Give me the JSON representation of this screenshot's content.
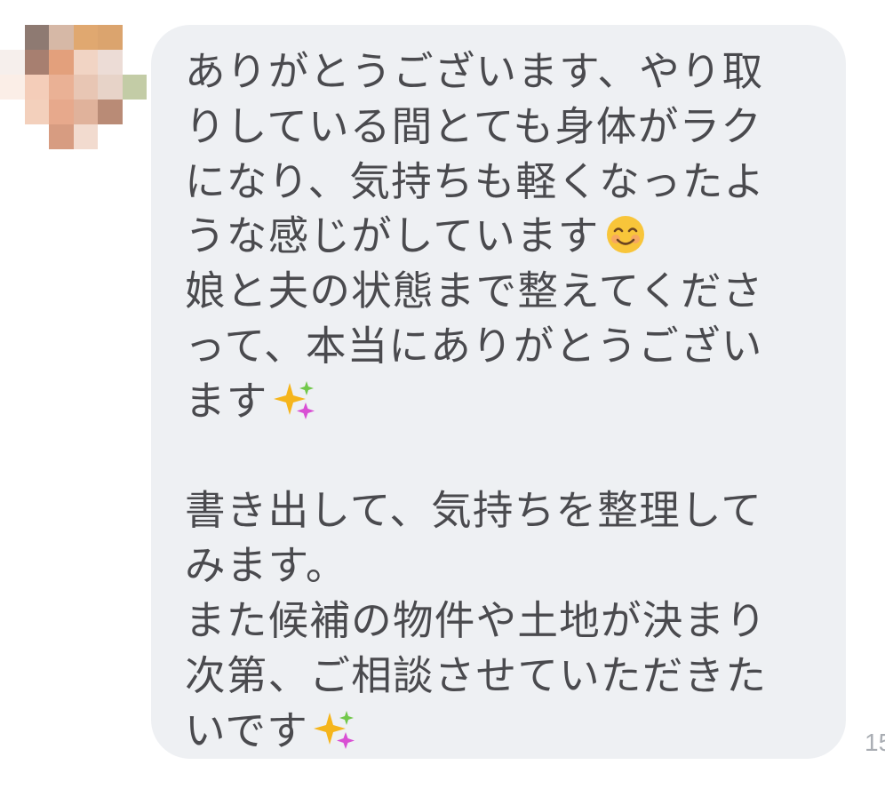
{
  "message": {
    "lines": [
      "ありがとうございます、やり取",
      "りしている間とても身体がラク",
      "になり、気持ちも軽くなったよ",
      "うな感じがしています",
      "娘と夫の状態まで整えてくださ",
      "って、本当にありがとうござい",
      "ます",
      "",
      "書き出して、気持ちを整理して",
      "みます。",
      "また候補の物件や土地が決まり",
      "次第、ご相談させていただきた",
      "いです"
    ],
    "emojis": [
      "smiling-face-emoji",
      "sparkles-emoji",
      "sparkles-emoji"
    ]
  },
  "timestamp": "15",
  "sender_avatar": "blurred-profile-photo",
  "colors": {
    "bubble": "#eef0f3",
    "text": "#4a4a4e",
    "timestamp": "#a9adb3",
    "background": "#ffffff"
  }
}
